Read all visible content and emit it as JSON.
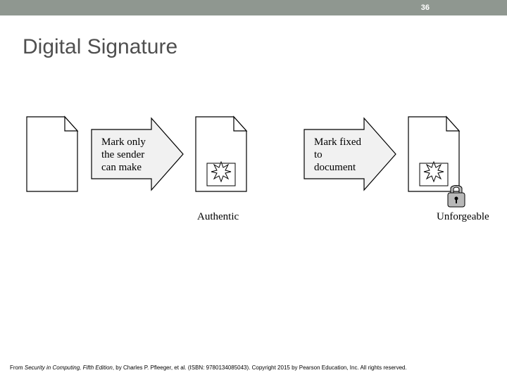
{
  "header": {
    "page_number": "36"
  },
  "title": "Digital Signature",
  "diagram": {
    "arrow1_line1": "Mark only",
    "arrow1_line2": "the sender",
    "arrow1_line3": "can make",
    "arrow2_line1": "Mark fixed",
    "arrow2_line2": "to",
    "arrow2_line3": "document",
    "caption1": "Authentic",
    "caption2": "Unforgeable"
  },
  "footer": {
    "prefix": "From ",
    "book": "Security in Computing, Fifth Edition",
    "rest": ", by Charles P. Pfleeger, et al. (ISBN: 9780134085043). Copyright 2015 by Pearson Education, Inc. All rights reserved."
  }
}
